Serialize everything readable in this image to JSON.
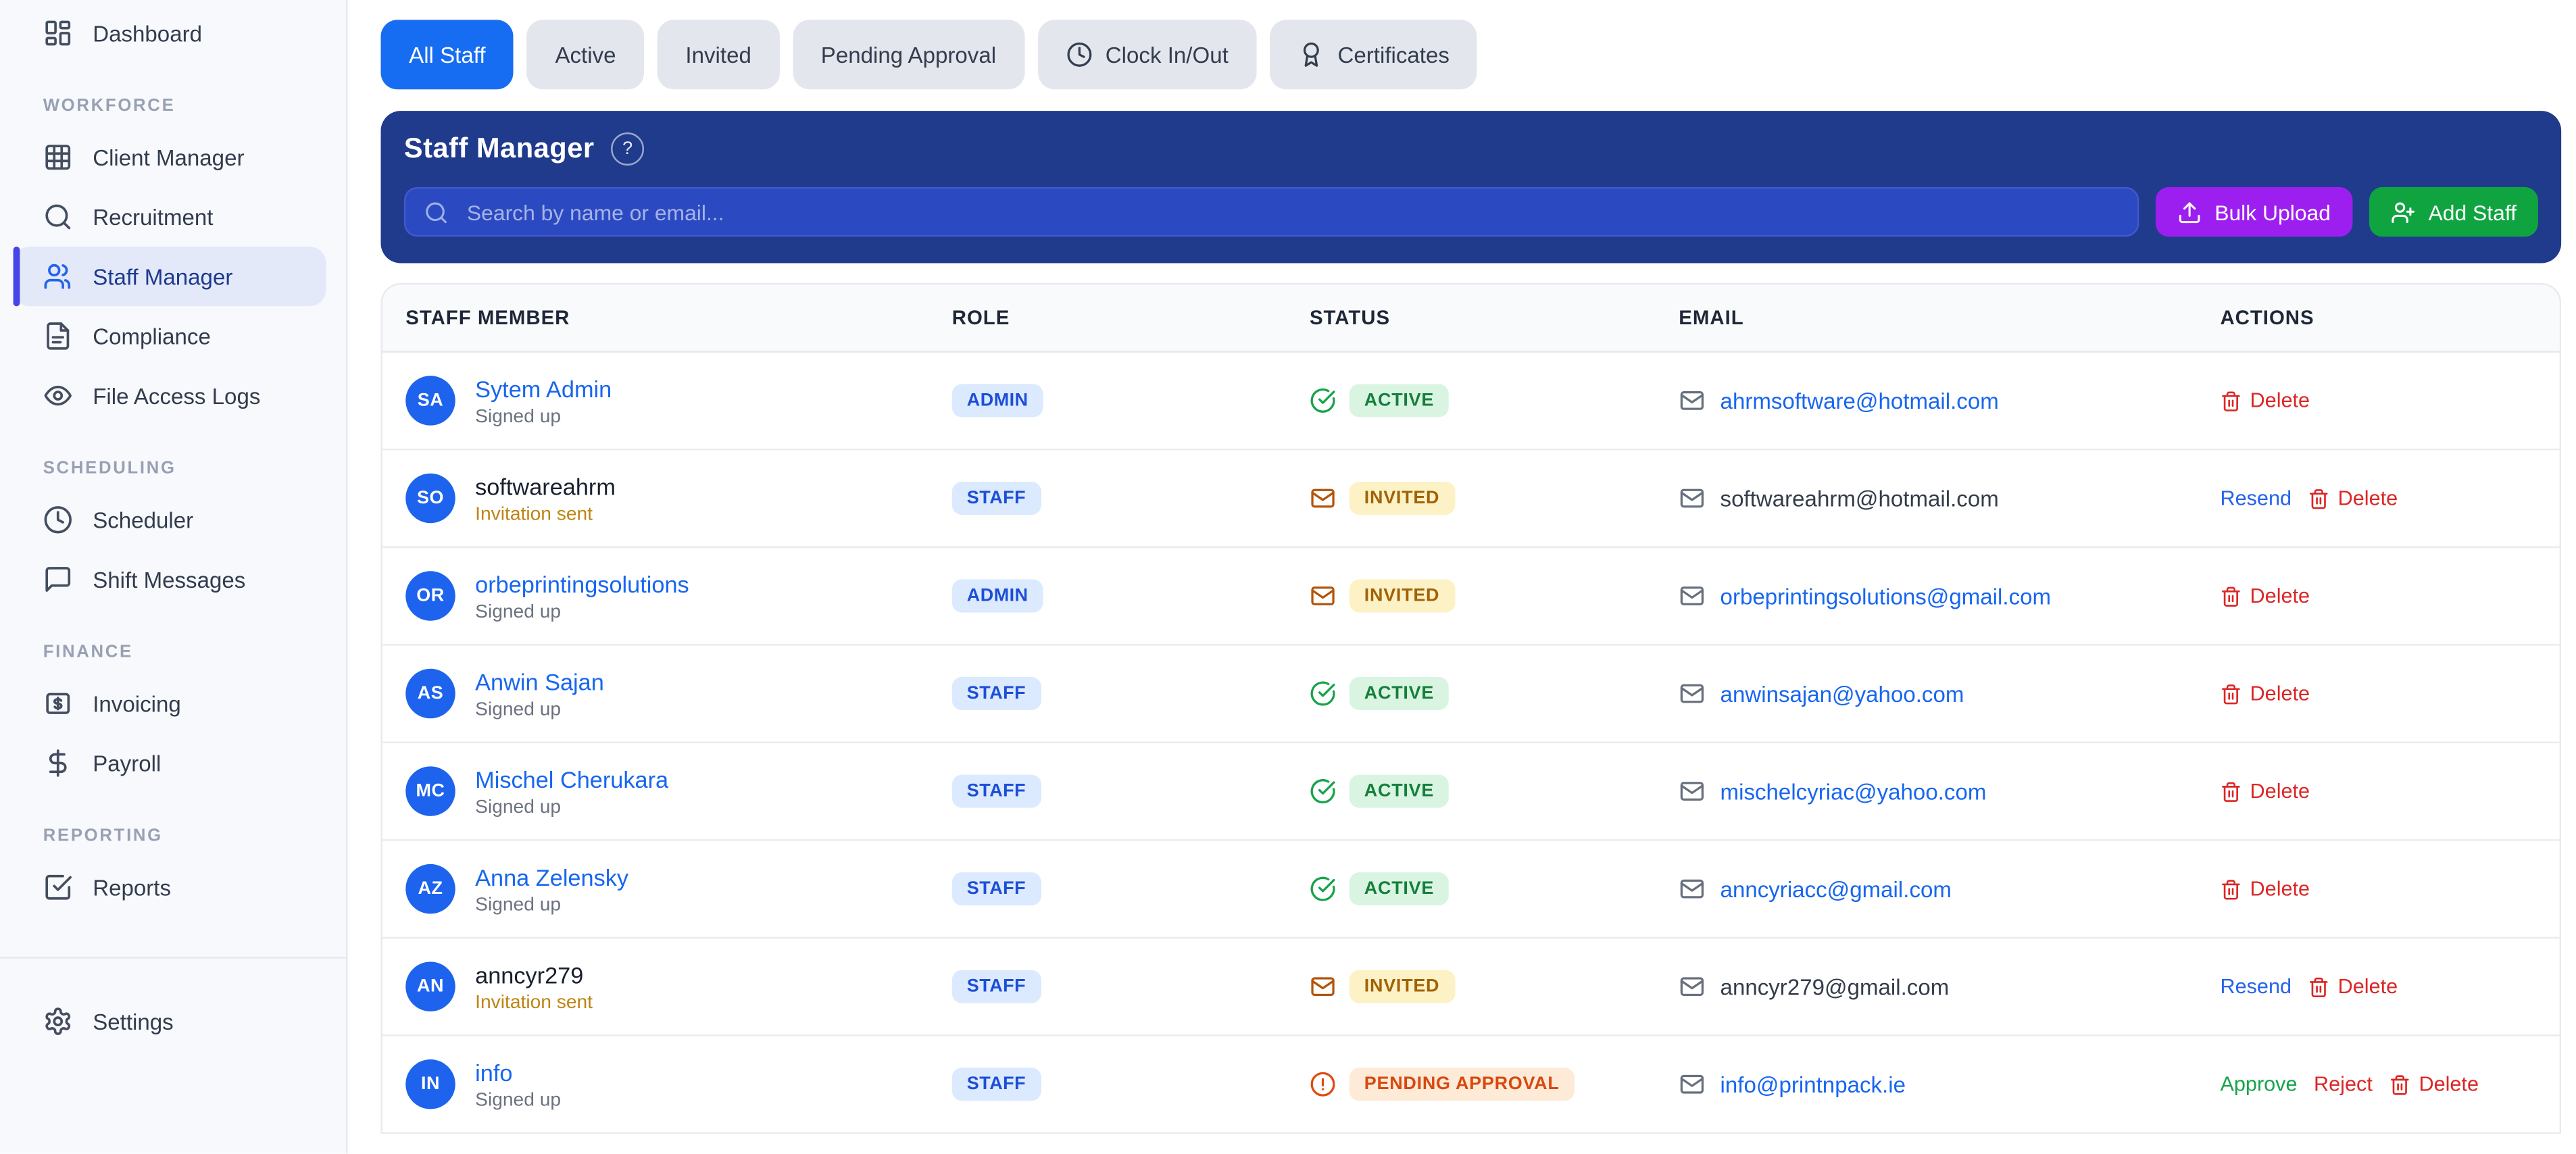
{
  "colors": {
    "accent_blue": "#176df2",
    "panel_navy": "#203a8c",
    "bulk_upload_purple": "#9d1ff0",
    "add_staff_green": "#10a441",
    "link_blue": "#1766f0",
    "delete_red": "#dc2626",
    "active_green": "#157f3c",
    "invited_amber": "#a16207",
    "pending_orange": "#d9480f",
    "sidebar_active_bg": "#e4e9f9"
  },
  "sidebar": {
    "dashboard": {
      "label": "Dashboard",
      "icon": "dashboard-icon"
    },
    "groups": [
      {
        "title": "WORKFORCE",
        "items": [
          {
            "label": "Client Manager",
            "icon": "grid-icon"
          },
          {
            "label": "Recruitment",
            "icon": "search-icon"
          },
          {
            "label": "Staff Manager",
            "icon": "users-icon",
            "active": true
          },
          {
            "label": "Compliance",
            "icon": "file-text-icon"
          },
          {
            "label": "File Access Logs",
            "icon": "eye-icon"
          }
        ]
      },
      {
        "title": "SCHEDULING",
        "items": [
          {
            "label": "Scheduler",
            "icon": "clock-icon"
          },
          {
            "label": "Shift Messages",
            "icon": "message-icon"
          }
        ]
      },
      {
        "title": "FINANCE",
        "items": [
          {
            "label": "Invoicing",
            "icon": "receipt-icon"
          },
          {
            "label": "Payroll",
            "icon": "dollar-icon"
          }
        ]
      },
      {
        "title": "REPORTING",
        "items": [
          {
            "label": "Reports",
            "icon": "check-square-icon"
          }
        ]
      }
    ],
    "settings": {
      "label": "Settings",
      "icon": "gear-icon"
    }
  },
  "tabs": [
    {
      "label": "All Staff",
      "active": true
    },
    {
      "label": "Active"
    },
    {
      "label": "Invited"
    },
    {
      "label": "Pending Approval"
    },
    {
      "label": "Clock In/Out",
      "icon": "clock-icon"
    },
    {
      "label": "Certificates",
      "icon": "award-icon"
    }
  ],
  "panel": {
    "title": "Staff Manager",
    "help_icon": "?",
    "search_placeholder": "Search by name or email...",
    "search_value": "",
    "bulk_upload_label": "Bulk Upload",
    "add_staff_label": "Add Staff"
  },
  "table": {
    "headers": [
      "STAFF MEMBER",
      "ROLE",
      "STATUS",
      "EMAIL",
      "ACTIONS"
    ],
    "rows": [
      {
        "initials": "SA",
        "name": "Sytem Admin",
        "name_is_link": true,
        "sub": "Signed up",
        "role": "ADMIN",
        "status": "ACTIVE",
        "status_icon": "check-circle-icon",
        "email": "ahrmsoftware@hotmail.com",
        "email_is_link": true,
        "actions": {
          "delete": "Delete"
        }
      },
      {
        "initials": "SO",
        "name": "softwareahrm",
        "name_is_link": false,
        "sub": "Invitation sent",
        "role": "STAFF",
        "status": "INVITED",
        "status_icon": "mail-icon",
        "email": "softwareahrm@hotmail.com",
        "email_is_link": false,
        "actions": {
          "resend": "Resend",
          "delete": "Delete"
        }
      },
      {
        "initials": "OR",
        "name": "orbeprintingsolutions",
        "name_is_link": true,
        "sub": "Signed up",
        "role": "ADMIN",
        "status": "INVITED",
        "status_icon": "mail-icon",
        "email": "orbeprintingsolutions@gmail.com",
        "email_is_link": true,
        "actions": {
          "delete": "Delete"
        }
      },
      {
        "initials": "AS",
        "name": "Anwin Sajan",
        "name_is_link": true,
        "sub": "Signed up",
        "role": "STAFF",
        "status": "ACTIVE",
        "status_icon": "check-circle-icon",
        "email": "anwinsajan@yahoo.com",
        "email_is_link": true,
        "actions": {
          "delete": "Delete"
        }
      },
      {
        "initials": "MC",
        "name": "Mischel Cherukara",
        "name_is_link": true,
        "sub": "Signed up",
        "role": "STAFF",
        "status": "ACTIVE",
        "status_icon": "check-circle-icon",
        "email": "mischelcyriac@yahoo.com",
        "email_is_link": true,
        "actions": {
          "delete": "Delete"
        }
      },
      {
        "initials": "AZ",
        "name": "Anna Zelensky",
        "name_is_link": true,
        "sub": "Signed up",
        "role": "STAFF",
        "status": "ACTIVE",
        "status_icon": "check-circle-icon",
        "email": "anncyriacc@gmail.com",
        "email_is_link": true,
        "actions": {
          "delete": "Delete"
        }
      },
      {
        "initials": "AN",
        "name": "anncyr279",
        "name_is_link": false,
        "sub": "Invitation sent",
        "role": "STAFF",
        "status": "INVITED",
        "status_icon": "mail-icon",
        "email": "anncyr279@gmail.com",
        "email_is_link": false,
        "actions": {
          "resend": "Resend",
          "delete": "Delete"
        }
      },
      {
        "initials": "IN",
        "name": "info",
        "name_is_link": true,
        "sub": "Signed up",
        "role": "STAFF",
        "status": "PENDING APPROVAL",
        "status_icon": "alert-circle-icon",
        "email": "info@printnpack.ie",
        "email_is_link": true,
        "actions": {
          "approve": "Approve",
          "reject": "Reject",
          "delete": "Delete"
        }
      }
    ]
  }
}
